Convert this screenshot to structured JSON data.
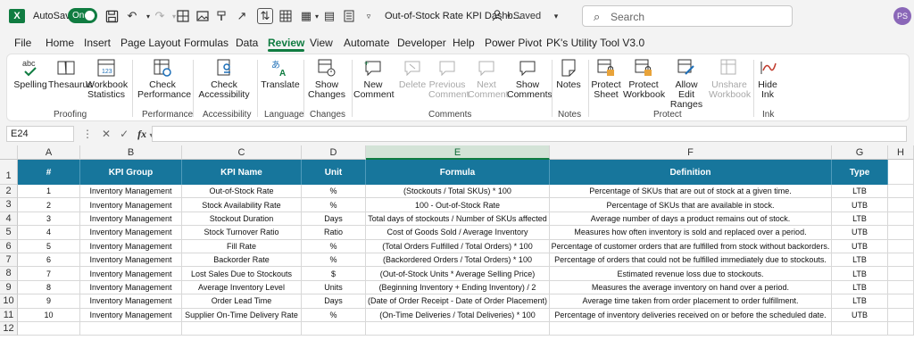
{
  "app": {
    "autosave_label": "AutoSave",
    "autosave_state": "On",
    "doc_title": "Out-of-Stock Rate KPI Dashb...",
    "saved_status": "• Saved",
    "search_placeholder": "Search",
    "avatar_initials": "PS",
    "brand_color": "#107c41"
  },
  "menu": [
    "File",
    "Home",
    "Insert",
    "Page Layout",
    "Formulas",
    "Data",
    "Review",
    "View",
    "Automate",
    "Developer",
    "Help",
    "Power Pivot",
    "PK's Utility Tool V3.0"
  ],
  "menu_active": "Review",
  "ribbon": {
    "proofing": {
      "label": "Proofing",
      "spelling": "Spelling",
      "thesaurus": "Thesaurus",
      "workbook_statistics": "Workbook Statistics"
    },
    "performance": {
      "label": "Performance",
      "check_performance": "Check Performance"
    },
    "accessibility": {
      "label": "Accessibility",
      "check_accessibility": "Check Accessibility"
    },
    "language": {
      "label": "Language",
      "translate": "Translate"
    },
    "changes": {
      "label": "Changes",
      "show_changes": "Show Changes"
    },
    "comments": {
      "label": "Comments",
      "new_comment": "New Comment",
      "delete": "Delete",
      "previous_comment": "Previous Comment",
      "next_comment": "Next Comment",
      "show_comments": "Show Comments"
    },
    "notes": {
      "label": "Notes",
      "notes": "Notes"
    },
    "protect": {
      "label": "Protect",
      "protect_sheet": "Protect Sheet",
      "protect_workbook": "Protect Workbook",
      "allow_edit_ranges": "Allow Edit Ranges",
      "unshare_workbook": "Unshare Workbook"
    },
    "ink": {
      "label": "Ink",
      "hide_ink": "Hide Ink"
    }
  },
  "formula_bar": {
    "cell_ref": "E24",
    "fx": "fx",
    "value": ""
  },
  "columns": [
    "A",
    "B",
    "C",
    "D",
    "E",
    "F",
    "G",
    "H"
  ],
  "selected_column": "E",
  "table": {
    "headers": [
      "#",
      "KPI Group",
      "KPI Name",
      "Unit",
      "Formula",
      "Definition",
      "Type"
    ],
    "rows": [
      [
        "1",
        "Inventory Management",
        "Out-of-Stock Rate",
        "%",
        "(Stockouts / Total SKUs) * 100",
        "Percentage of SKUs that are out of stock at a given time.",
        "LTB"
      ],
      [
        "2",
        "Inventory Management",
        "Stock Availability Rate",
        "%",
        "100 - Out-of-Stock Rate",
        "Percentage of SKUs that are available in stock.",
        "UTB"
      ],
      [
        "3",
        "Inventory Management",
        "Stockout Duration",
        "Days",
        "Total days of stockouts / Number of SKUs affected",
        "Average number of days a product remains out of stock.",
        "LTB"
      ],
      [
        "4",
        "Inventory Management",
        "Stock Turnover Ratio",
        "Ratio",
        "Cost of Goods Sold / Average Inventory",
        "Measures how often inventory is sold and replaced over a period.",
        "UTB"
      ],
      [
        "5",
        "Inventory Management",
        "Fill Rate",
        "%",
        "(Total Orders Fulfilled / Total Orders) * 100",
        "Percentage of customer orders that are fulfilled from stock without backorders.",
        "UTB"
      ],
      [
        "6",
        "Inventory Management",
        "Backorder Rate",
        "%",
        "(Backordered Orders / Total Orders) * 100",
        "Percentage of orders that could not be fulfilled immediately due to stockouts.",
        "LTB"
      ],
      [
        "7",
        "Inventory Management",
        "Lost Sales Due to Stockouts",
        "$",
        "(Out-of-Stock Units * Average Selling Price)",
        "Estimated revenue loss due to stockouts.",
        "LTB"
      ],
      [
        "8",
        "Inventory Management",
        "Average Inventory Level",
        "Units",
        "(Beginning Inventory + Ending Inventory) / 2",
        "Measures the average inventory on hand over a period.",
        "LTB"
      ],
      [
        "9",
        "Inventory Management",
        "Order Lead Time",
        "Days",
        "(Date of Order Receipt - Date of Order Placement)",
        "Average time taken from order placement to order fulfillment.",
        "LTB"
      ],
      [
        "10",
        "Inventory Management",
        "Supplier On-Time Delivery Rate",
        "%",
        "(On-Time Deliveries / Total Deliveries) * 100",
        "Percentage of inventory deliveries received on or before the scheduled date.",
        "UTB"
      ]
    ],
    "row_numbers": [
      "1",
      "2",
      "3",
      "4",
      "5",
      "6",
      "7",
      "8",
      "9",
      "10",
      "11",
      "12"
    ],
    "header_color": "#17769c"
  }
}
